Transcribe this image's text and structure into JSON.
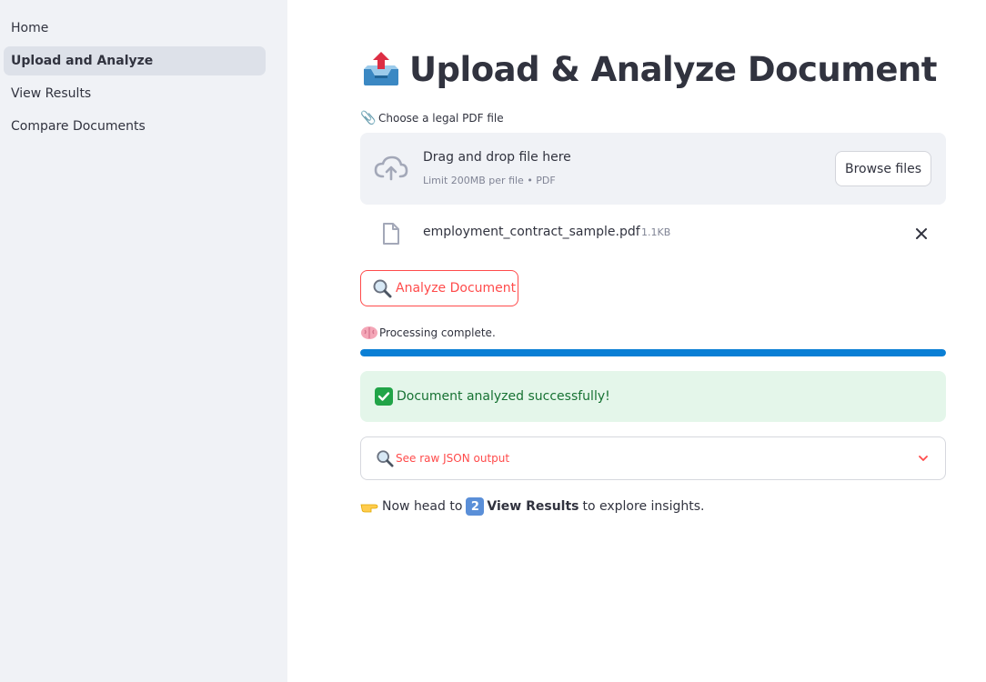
{
  "sidebar": {
    "items": [
      {
        "label": "Home"
      },
      {
        "label": "Upload and Analyze"
      },
      {
        "label": "View Results"
      },
      {
        "label": "Compare Documents"
      }
    ],
    "active_index": 1
  },
  "page": {
    "title": "Upload & Analyze Document",
    "title_icon": "outbox-tray-icon"
  },
  "uploader": {
    "label": "Choose a legal PDF file",
    "label_icon": "paperclip-icon",
    "drop_text": "Drag and drop file here",
    "limit_text": "Limit 200MB per file • PDF",
    "browse_label": "Browse files",
    "file": {
      "name": "employment_contract_sample.pdf",
      "size": "1.1KB"
    }
  },
  "analyze_button": {
    "label": "Analyze Document",
    "icon": "magnifier-icon"
  },
  "progress": {
    "text": "Processing complete.",
    "icon": "brain-icon",
    "value": 1.0
  },
  "success": {
    "text": "Document analyzed successfully!",
    "icon": "check-mark-icon"
  },
  "expander": {
    "label": "See raw JSON output",
    "icon": "magnifier-icon"
  },
  "footer": {
    "prefix": "Now head to",
    "number": "2",
    "bold": "View Results",
    "suffix": "to explore insights."
  },
  "colors": {
    "accent": "#ff4b4b",
    "progress": "#0a7fd5",
    "success_bg": "#e4f6ea",
    "success_text": "#177233",
    "sidebar_bg": "#f0f2f6"
  }
}
